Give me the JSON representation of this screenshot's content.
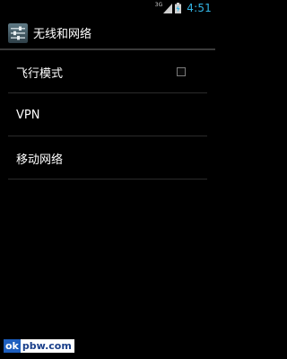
{
  "status_bar": {
    "network_type": "3G",
    "time": "4:51",
    "signal_icon": "signal-bars-icon",
    "battery_icon": "battery-charging-icon",
    "accent_color": "#33b5e5"
  },
  "action_bar": {
    "title": "无线和网络",
    "icon": "settings-sliders-icon"
  },
  "settings": {
    "items": [
      {
        "label": "飞行模式",
        "checked": false
      },
      {
        "label": "VPN"
      },
      {
        "label": "移动网络"
      }
    ]
  },
  "watermark": {
    "prefix": "ok",
    "rest": "pbw.com"
  }
}
